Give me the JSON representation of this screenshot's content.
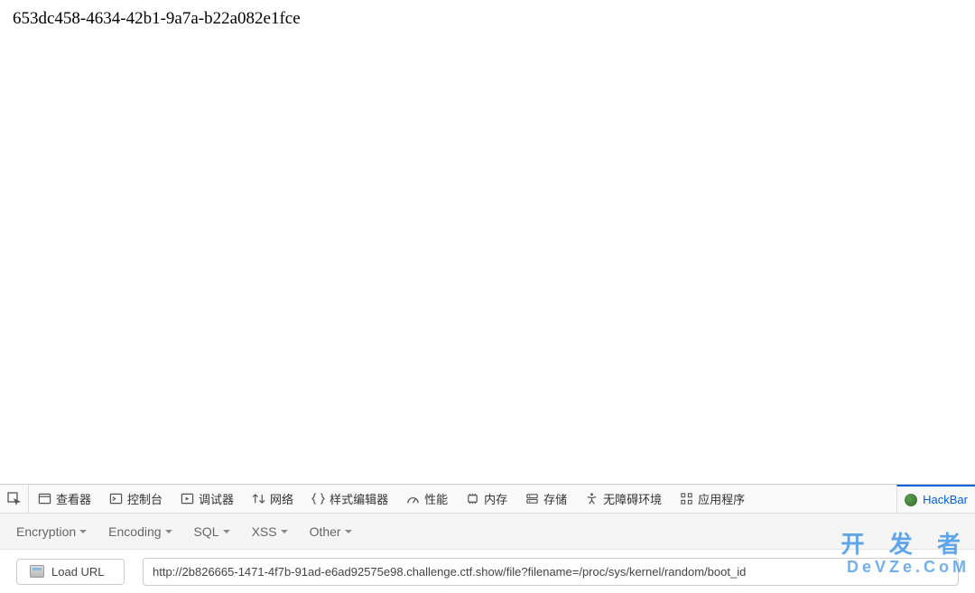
{
  "page": {
    "body_text": "653dc458-4634-42b1-9a7a-b22a082e1fce"
  },
  "devtools": {
    "tabs": [
      {
        "label": "查看器"
      },
      {
        "label": "控制台"
      },
      {
        "label": "调试器"
      },
      {
        "label": "网络"
      },
      {
        "label": "样式编辑器"
      },
      {
        "label": "性能"
      },
      {
        "label": "内存"
      },
      {
        "label": "存储"
      },
      {
        "label": "无障碍环境"
      },
      {
        "label": "应用程序"
      }
    ],
    "active_tab": "HackBar"
  },
  "hackbar": {
    "dropdowns": [
      {
        "label": "Encryption"
      },
      {
        "label": "Encoding"
      },
      {
        "label": "SQL"
      },
      {
        "label": "XSS"
      },
      {
        "label": "Other"
      }
    ],
    "load_url_label": "Load URL",
    "url_value": "http://2b826665-1471-4f7b-91ad-e6ad92575e98.challenge.ctf.show/file?filename=/proc/sys/kernel/random/boot_id"
  },
  "watermark": {
    "line1": "开 发 者",
    "line2": "DeVZe.CoM"
  }
}
